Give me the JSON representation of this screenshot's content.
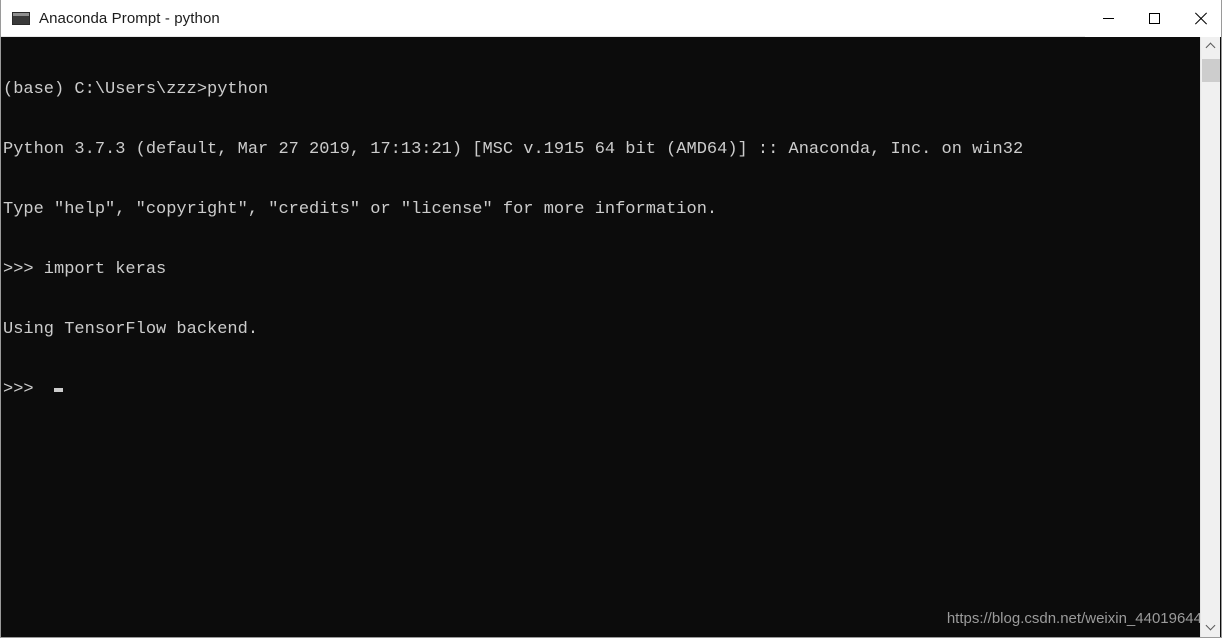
{
  "window": {
    "title": "Anaconda Prompt - python",
    "icon": "console-window-icon",
    "background_color": "#0c0c0c",
    "titlebar_color": "#ffffff",
    "text_color": "#cccccc"
  },
  "titlebar_buttons": {
    "minimize": "minimize-icon",
    "maximize": "maximize-icon",
    "close": "close-icon"
  },
  "console": {
    "lines": [
      "(base) C:\\Users\\zzz>python",
      "Python 3.7.3 (default, Mar 27 2019, 17:13:21) [MSC v.1915 64 bit (AMD64)] :: Anaconda, Inc. on win32",
      "Type \"help\", \"copyright\", \"credits\" or \"license\" for more information.",
      ">>> import keras",
      "Using TensorFlow backend.",
      ">>> "
    ],
    "line_1": "(base) C:\\Users\\zzz>python",
    "line_2": "Python 3.7.3 (default, Mar 27 2019, 17:13:21) [MSC v.1915 64 bit (AMD64)] :: Anaconda, Inc. on win32",
    "line_3": "Type \"help\", \"copyright\", \"credits\" or \"license\" for more information.",
    "line_4": ">>> import keras",
    "line_5": "Using TensorFlow backend.",
    "line_6": ">>> ",
    "cursor_visible": true
  },
  "watermark": {
    "text": "https://blog.csdn.net/weixin_44019644"
  },
  "scrollbar": {
    "up_arrow": "chevron-up-icon",
    "down_arrow": "chevron-down-icon",
    "thumb": "scrollbar-thumb"
  }
}
